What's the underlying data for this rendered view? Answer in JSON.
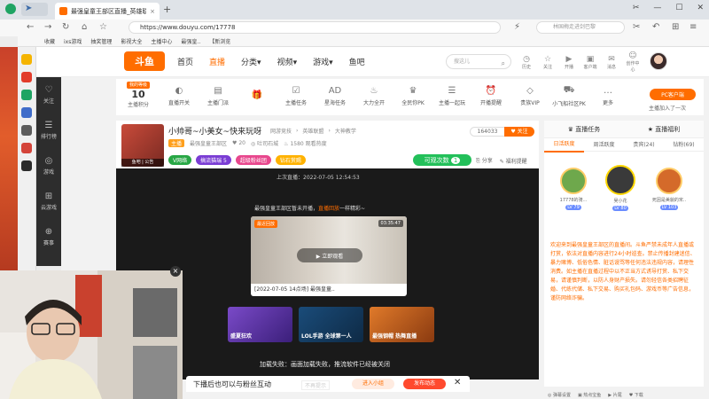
{
  "browser": {
    "tab_title": "最强皇童王部区直播_英雄联盟",
    "tab_close": "×",
    "new_tab": "+",
    "url": "https://www.douyu.com/17778",
    "search_placeholder": "林国梅走进剑巴黎",
    "bookmarks": [
      "收藏",
      "ixs游戏",
      "抽奖管理",
      "影视大全",
      "主播中心",
      "最强皇..",
      "【新浏览"
    ],
    "win_buttons": [
      "✂",
      "—",
      "☐",
      "✕"
    ]
  },
  "header": {
    "logo": "斗鱼",
    "nav": [
      "首页",
      "直播",
      "分类",
      "视频",
      "游戏",
      "鱼吧"
    ],
    "active_nav": "直播",
    "search_placeholder": "搜这儿",
    "user_icons": [
      {
        "glyph": "◷",
        "label": "历史"
      },
      {
        "glyph": "☆",
        "label": "关注"
      },
      {
        "glyph": "▶",
        "label": "开播"
      },
      {
        "glyph": "▣",
        "label": "客户端"
      },
      {
        "glyph": "✉",
        "label": "消息"
      },
      {
        "glyph": "☺",
        "label": "创作中心"
      }
    ]
  },
  "left_nav": [
    {
      "glyph": "♡",
      "label": "关注"
    },
    {
      "glyph": "☰",
      "label": "排行榜"
    },
    {
      "glyph": "◎",
      "label": "游戏"
    },
    {
      "glyph": "⊞",
      "label": "云游戏"
    },
    {
      "glyph": "⊕",
      "label": "赛事"
    }
  ],
  "toolbar": {
    "level_tag": "我的等级",
    "level_value": "10",
    "level_label": "主播积分",
    "items": [
      {
        "glyph": "◐",
        "label": "直播开关"
      },
      {
        "glyph": "▤",
        "label": "主播门派"
      },
      {
        "glyph": "🎁",
        "label": ""
      },
      {
        "glyph": "☑",
        "label": "主播任务"
      },
      {
        "glyph": "AD",
        "label": "星海任务"
      },
      {
        "glyph": "♨",
        "label": "大力全开"
      },
      {
        "glyph": "♛",
        "label": "全民你PK"
      },
      {
        "glyph": "☰",
        "label": "主播一起玩"
      },
      {
        "glyph": "⏰",
        "label": "开播提醒"
      },
      {
        "glyph": "◇",
        "label": "贵族VIP"
      },
      {
        "glyph": "⛟",
        "label": "小飞船社区PK"
      },
      {
        "glyph": "…",
        "label": "更多"
      }
    ],
    "pc_client": "PC客户端",
    "pc_sub": "主播加入了一次"
  },
  "stream": {
    "title": "小帅哥~小美女~快来玩呀",
    "meta_tag1": "网游竞技",
    "meta_tag2": "英雄联盟",
    "meta_tag3": "大神教学",
    "badge": "主播",
    "anchor_name": "最强皇童王部区",
    "fans_count": "20",
    "city": "吐司石城",
    "viewers": "1580 观看热度",
    "level_badge": "鱼吧 | 公告",
    "tags": [
      {
        "text": "V网络",
        "color": "#28a745"
      },
      {
        "text": "搞流猫瑞 5",
        "color": "#7a3dd4"
      },
      {
        "text": "超级粉丝团",
        "color": "#e8478d"
      },
      {
        "text": "钻石赏赐",
        "color": "#ffb200"
      }
    ],
    "follow_count": "164033",
    "follow_label": "♥ 关注",
    "task_label": "可观次数",
    "task_count": "1",
    "share": "分享",
    "report": "福利提醒"
  },
  "video": {
    "last_time": "上次直播：2022-07-05 12:54:53",
    "last_note_pre": "最强皇童王部区暂未开播，",
    "last_note_hl": "直播回放",
    "last_note_post": "一样精彩~",
    "rec_badge": "最近回放",
    "rec_duration": "03:35:47",
    "rec_play": "▶ 立即观看",
    "rec_title": "[2022-07-05 14点场] 最强皇童..",
    "thumbs": [
      {
        "text": "盛夏狂欢",
        "bg": "#7a4ac8"
      },
      {
        "text": "LOL手游 全球第一人",
        "bg": "#1a4c7a"
      },
      {
        "text": "最强钢帽 热舞直播",
        "bg": "#d06a2a"
      }
    ],
    "load_fail": "加载失败：画面加载失败，推流软件已经被关闭"
  },
  "interaction": {
    "text": "下播后也可以与粉丝互动",
    "note": "不再提示",
    "btn1": "进入小组",
    "btn2": "发布动态",
    "close": "✕"
  },
  "right_panel": {
    "header_left": "♛ 直播任务",
    "header_mid": "★ 直播福利",
    "tabs": [
      "日活跃度",
      "周活跃度",
      "贵宾(24)",
      "钻粉(69)"
    ],
    "active_tab": "日活跃度",
    "ranks": [
      {
        "name": "17778的骑...",
        "level": "LV 79",
        "color": "#6ea84c"
      },
      {
        "name": "吴小花",
        "level": "LV 80",
        "color": "#3a3a3a"
      },
      {
        "name": "死因是美貌的宋..",
        "level": "LV 103",
        "color": "#d46a2a"
      }
    ],
    "welcome": "欢迎来到最强皇童王部区的直播间。斗鱼严禁未成年人直播或打赏，依法对直播内容进行24小时巡查。禁止传播封建迷信、暴力赌博、低俗色情、脏话谩骂等任何违法违规内容，请理性消费。如主播在直播过程中以不正当方式诱导打赏、私下交易，请谨慎判断，以防人身财产损失。请勿轻信各类招聘征婚、代练代储、私下交易、购买礼包码、游戏币等广告信息，谨防网络诈骗。",
    "bottom": [
      "◎ 弹幕设置",
      "▣ 热点宝鱼",
      "▶ 片尾",
      "♥ 下载"
    ]
  }
}
